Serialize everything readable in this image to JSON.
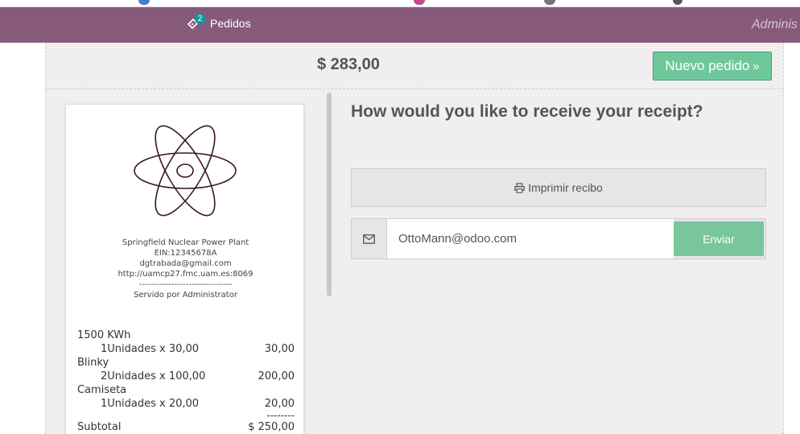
{
  "navbar": {
    "orders_label": "Pedidos",
    "orders_count": "2",
    "user_label": "Adminis"
  },
  "order": {
    "total": "$ 283,00",
    "next_order_label": "Nuevo pedido"
  },
  "receipt": {
    "company_name": "Springfield Nuclear Power Plant",
    "ein": "EIN:12345678A",
    "email": "dgtrabada@gmail.com",
    "website": "http://uamcp27.fmc.uam.es:8069",
    "separator": "--------------------------------",
    "served_by": "Servido por Administrator",
    "lines": [
      {
        "product": "1500 KWh",
        "detail": "1Unidades x 30,00",
        "amount": "30,00"
      },
      {
        "product": "Blinky",
        "detail": "2Unidades x 100,00",
        "amount": "200,00"
      },
      {
        "product": "Camiseta",
        "detail": "1Unidades x 20,00",
        "amount": "20,00"
      }
    ],
    "total_divider": "--------",
    "subtotal_label": "Subtotal",
    "subtotal_value": "$ 250,00"
  },
  "receipt_options": {
    "question": "How would you like to receive your receipt?",
    "print_label": "Imprimir recibo",
    "email_value": "OttoMann@odoo.com",
    "send_label": "Enviar"
  },
  "colors": {
    "navbar": "#875a7b",
    "badge": "#00a09d",
    "next_button": "#6ec89b",
    "send_button": "#79c59c"
  },
  "icons": {
    "orders": "tickets-icon",
    "next": "double-chevron-right-icon",
    "print": "printer-icon",
    "email": "envelope-icon",
    "logo": "atom-logo"
  }
}
